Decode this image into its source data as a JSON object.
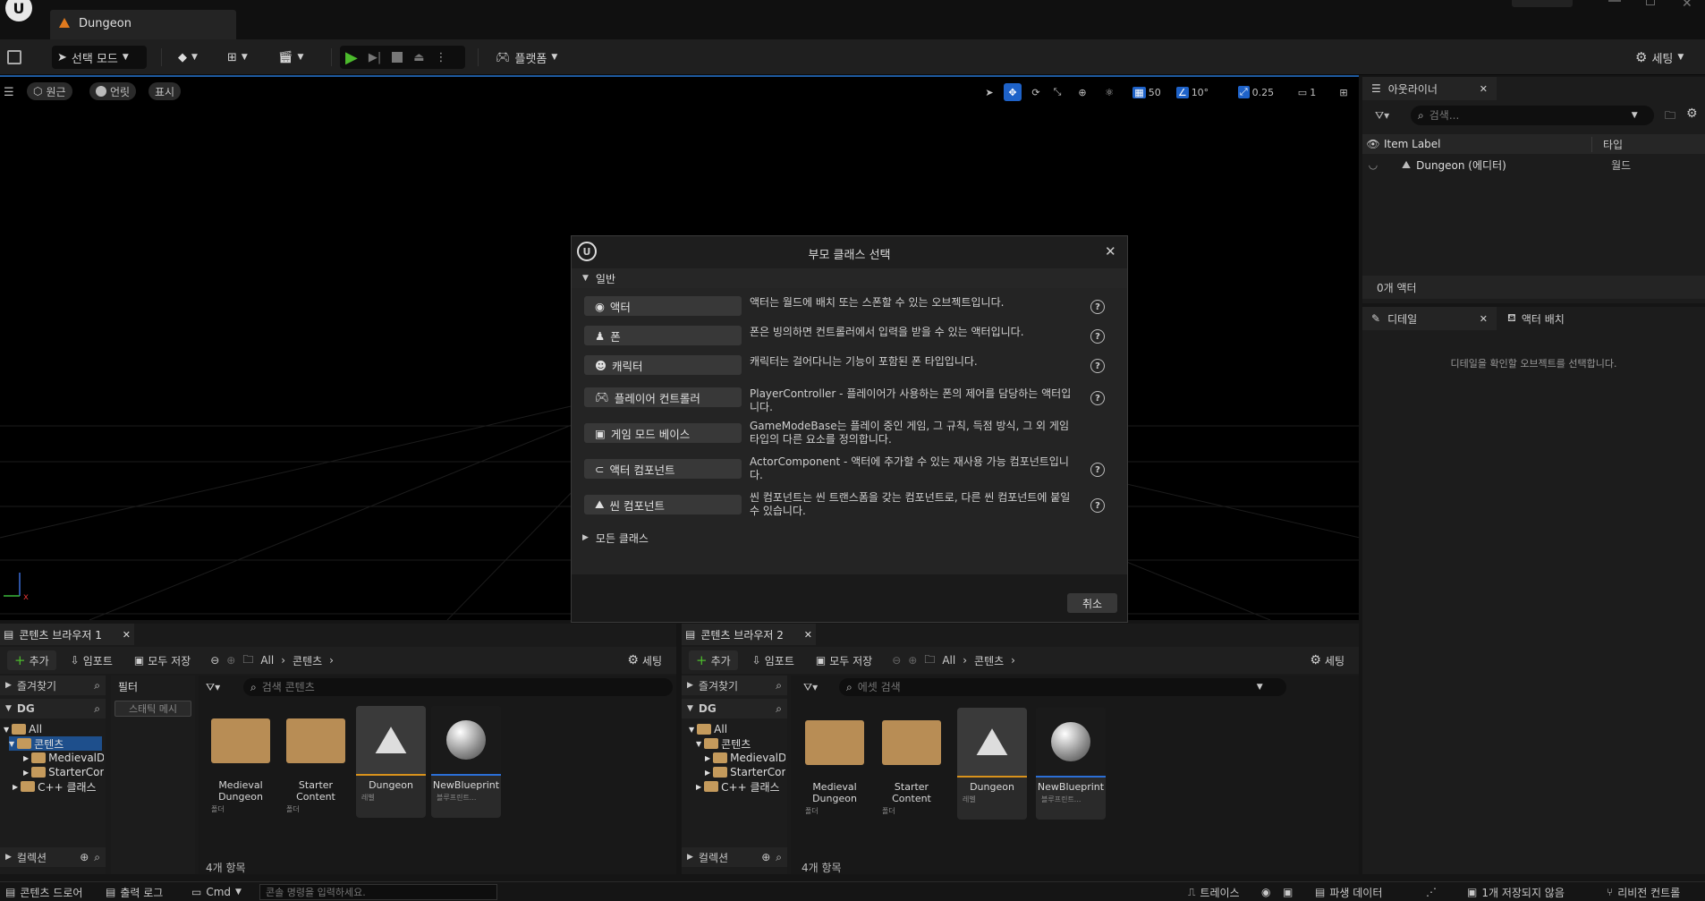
{
  "window": {
    "tab_label": "Dungeon"
  },
  "toolbar": {
    "select_mode": "선택 모드",
    "platforms": "플랫폼",
    "settings": "세팅"
  },
  "viewport": {
    "perspective": "원근",
    "lit": "언릿",
    "show": "표시",
    "grid_size": "50",
    "rotation_snap": "10°",
    "scale_snap": "0.25",
    "camera_speed": "1"
  },
  "outliner": {
    "tab_label": "아웃라이너",
    "search_placeholder": "검색...",
    "col_label": "Item Label",
    "col_type": "타입",
    "rows": [
      {
        "label": "Dungeon (에디터)",
        "type": "월드"
      }
    ],
    "actor_count": "0개 액터"
  },
  "details": {
    "tab_label": "디테일",
    "tab2_label": "액터 배치",
    "empty_message": "디테일을 확인할 오브젝트를 선택합니다."
  },
  "dialog": {
    "title": "부모 클래스 선택",
    "section_common": "일반",
    "section_all": "모든 클래스",
    "cancel": "취소",
    "classes": [
      {
        "label": "액터",
        "desc": "액터는 월드에 배치 또는 스폰할 수 있는 오브젝트입니다."
      },
      {
        "label": "폰",
        "desc": "폰은 빙의하면 컨트롤러에서 입력을 받을 수 있는 액터입니다."
      },
      {
        "label": "캐릭터",
        "desc": "캐릭터는 걸어다니는 기능이 포함된 폰 타입입니다."
      },
      {
        "label": "플레이어 컨트롤러",
        "desc": "PlayerController - 플레이어가 사용하는 폰의 제어를 담당하는 액터입니다."
      },
      {
        "label": "게임 모드 베이스",
        "desc": "GameModeBase는 플레이 중인 게임, 그 규칙, 득점 방식, 그 외 게임 타입의 다른 요소를 정의합니다."
      },
      {
        "label": "액터 컴포넌트",
        "desc": "ActorComponent - 액터에 추가할 수 있는 재사용 가능 컴포넌트입니다."
      },
      {
        "label": "씬 컴포넌트",
        "desc": "씬 컴포넌트는 씬 트랜스폼을 갖는 컴포넌트로, 다른 씬 컴포넌트에 붙일 수 있습니다."
      }
    ]
  },
  "cb1": {
    "tab_label": "콘텐츠 브라우저 1",
    "add": "추가",
    "import": "임포트",
    "save_all": "모두 저장",
    "crumb_all": "All",
    "crumb_content": "콘텐츠",
    "settings": "세팅",
    "favorites": "즐겨찾기",
    "project": "DG",
    "filter": "필터",
    "filter_chip": "스태틱 메시",
    "search_placeholder": "검색 콘텐츠",
    "tree": [
      "All",
      "콘텐츠",
      "MedievalD",
      "StarterCor",
      "C++ 클래스"
    ],
    "assets": [
      {
        "name": "Medieval Dungeon",
        "type": "폴더"
      },
      {
        "name": "Starter Content",
        "type": "폴더"
      },
      {
        "name": "Dungeon",
        "type": "레벨"
      },
      {
        "name": "NewBlueprint",
        "type": "블루프린트..."
      }
    ],
    "collections": "컬렉션",
    "count": "4개 항목"
  },
  "cb2": {
    "tab_label": "콘텐츠 브라우저 2",
    "add": "추가",
    "import": "임포트",
    "save_all": "모두 저장",
    "crumb_all": "All",
    "crumb_content": "콘텐츠",
    "settings": "세팅",
    "favorites": "즐겨찾기",
    "project": "DG",
    "search_placeholder": "에셋 검색",
    "tree": [
      "All",
      "콘텐츠",
      "MedievalD",
      "StarterCor",
      "C++ 클래스"
    ],
    "assets": [
      {
        "name": "Medieval Dungeon",
        "type": "폴더"
      },
      {
        "name": "Starter Content",
        "type": "폴더"
      },
      {
        "name": "Dungeon",
        "type": "레벨"
      },
      {
        "name": "NewBlueprint",
        "type": "블루프린트..."
      }
    ],
    "collections": "컬렉션",
    "count": "4개 항목"
  },
  "status": {
    "drawer": "콘텐츠 드로어",
    "output_log": "출력 로그",
    "cmd": "Cmd",
    "console_placeholder": "콘솔 명령을 입력하세요.",
    "trace": "트레이스",
    "derived_data": "파생 데이터",
    "unsaved": "1개 저장되지 않음",
    "revision": "리비전 컨트롤"
  }
}
